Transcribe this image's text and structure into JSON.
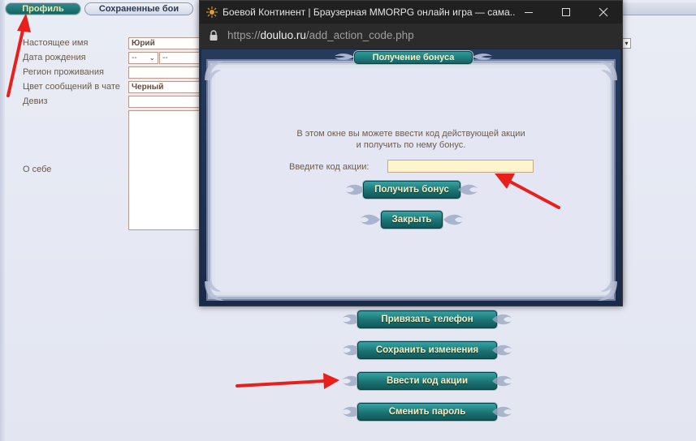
{
  "tabs": {
    "profile": "Профиль",
    "saved_battles": "Сохраненные бои"
  },
  "form": {
    "real_name_label": "Настоящее имя",
    "real_name_value": "Юрий",
    "birth_date_label": "Дата рождения",
    "birth_day_value": "--",
    "birth_month_value": "--",
    "region_label": "Регион проживания",
    "region_value": "",
    "chat_color_label": "Цвет сообщений в чате",
    "chat_color_value": "Черный",
    "motto_label": "Девиз",
    "motto_value": "",
    "about_label": "О себе",
    "about_value": ""
  },
  "actions": {
    "bind_phone": "Привязать телефон",
    "save_changes": "Сохранить изменения",
    "enter_promo": "Ввести код акции",
    "change_password": "Сменить пароль"
  },
  "browser": {
    "title": "Боевой Континент | Браузерная MMORPG онлайн игра — сама...",
    "url_scheme": "https://",
    "url_host": "douluo.ru",
    "url_path": "/add_action_code.php"
  },
  "bonus_popup": {
    "title": "Получение бонуса",
    "message_line1": "В этом окне вы можете ввести код действующей акции",
    "message_line2": "и получить по нему бонус.",
    "code_label": "Введите код акции:",
    "code_value": "",
    "get_bonus_button": "Получить бонус",
    "close_button": "Закрыть"
  },
  "colors": {
    "accent_teal": "#1b7273",
    "button_text": "#f6efc0",
    "annotation_arrow": "#e8201c",
    "input_highlight": "#fdf5cd"
  },
  "icons": [
    "favicon-icon",
    "minimize-icon",
    "maximize-icon",
    "close-icon",
    "lock-icon",
    "chevron-down-icon"
  ]
}
